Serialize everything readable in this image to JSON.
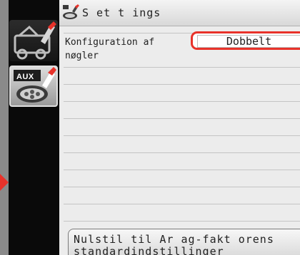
{
  "header": {
    "title": "S et t ings",
    "icon": "settings-tool-icon"
  },
  "sidebar": {
    "items": [
      {
        "name": "machine-icon",
        "active": false
      },
      {
        "name": "aux-icon",
        "label": "AUX",
        "active": true
      }
    ]
  },
  "setting": {
    "label": "Konfiguration af nøgler",
    "value": "Dobbelt"
  },
  "reset": {
    "label": "Nulstil til Ar ag-fakt orens standardindstillinger"
  },
  "colors": {
    "accent": "#e8322a",
    "panel": "#ececec",
    "sidebar": "#0a0a0a"
  }
}
